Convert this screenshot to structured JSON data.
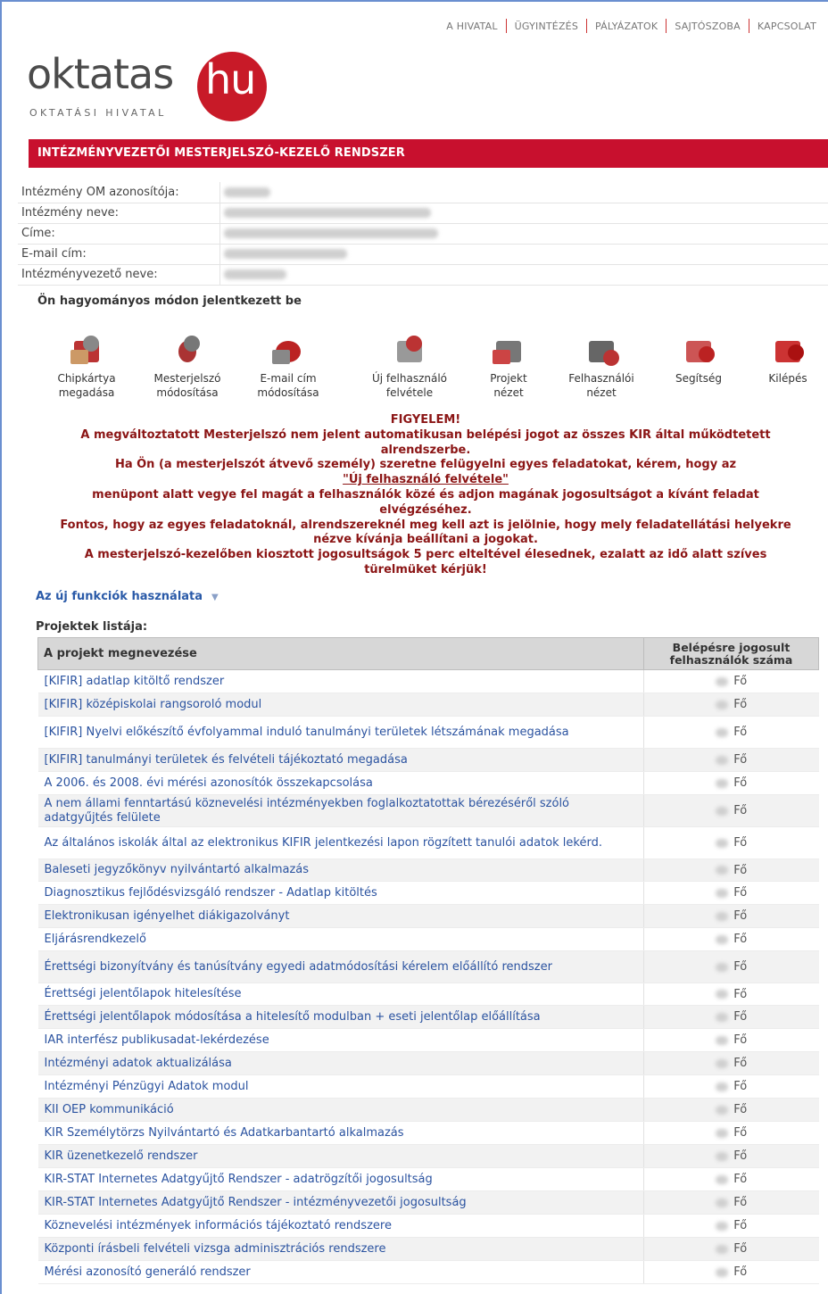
{
  "topnav": [
    "A HIVATAL",
    "ÜGYINTÉZÉS",
    "PÁLYÁZATOK",
    "SAJTÓSZOBA",
    "KAPCSOLAT"
  ],
  "logo": {
    "word": "oktatas",
    "domain": "hu",
    "subtitle": "OKTATÁSI HIVATAL"
  },
  "banner": "INTÉZMÉNYVEZETŐI MESTERJELSZÓ-KEZELŐ RENDSZER",
  "info_labels": [
    "Intézmény OM azonosítója:",
    "Intézmény neve:",
    "Címe:",
    "E-mail cím:",
    "Intézményvezető neve:"
  ],
  "login_note": "Ön hagyományos módon jelentkezett be",
  "tools": [
    {
      "l1": "Chipkártya",
      "l2": "megadása",
      "icon": "chipcard-icon"
    },
    {
      "l1": "Mesterjelszó",
      "l2": "módosítása",
      "icon": "keys-icon"
    },
    {
      "l1": "E-mail cím",
      "l2": "módosítása",
      "icon": "email-icon"
    },
    {
      "l1": "Új felhasználó",
      "l2": "felvétele",
      "icon": "add-user-icon"
    },
    {
      "l1": "Projekt",
      "l2": "nézet",
      "icon": "project-icon"
    },
    {
      "l1": "Felhasználói",
      "l2": "nézet",
      "icon": "user-view-icon"
    },
    {
      "l1": "Segítség",
      "l2": "",
      "icon": "help-icon"
    },
    {
      "l1": "Kilépés",
      "l2": "",
      "icon": "logout-icon"
    }
  ],
  "warning": {
    "title": "FIGYELEM!",
    "l1": "A megváltoztatott Mesterjelszó nem jelent automatikusan belépési jogot az összes KIR által működtetett",
    "l2": "alrendszerbe.",
    "l3": "Ha Ön (a mesterjelszót átvevő személy) szeretne felügyelni egyes feladatokat, kérem, hogy az",
    "l4": "\"Új felhasználó felvétele\"",
    "l5": "menüpont alatt vegye fel magát a felhasználók közé és adjon magának jogosultságot a kívánt feladat",
    "l6": "elvégzéséhez.",
    "l7": "Fontos, hogy az egyes feladatoknál, alrendszereknél meg kell azt is jelölnie, hogy mely feladatellátási helyekre",
    "l8": "nézve kívánja beállítani a jogokat.",
    "l9": "A mesterjelszó-kezelőben kiosztott jogosultságok 5 perc elteltével élesednek, ezalatt az idő alatt szíves",
    "l10": "türelmüket kérjük!"
  },
  "functions_link": "Az új funkciók használata",
  "projects_title": "Projektek listája:",
  "table": {
    "col1": "A projekt megnevezése",
    "col2_l1": "Belépésre jogosult",
    "col2_l2": "felhasználók száma",
    "unit": "Fő",
    "rows": [
      "[KIFIR] adatlap kitöltő rendszer",
      "[KIFIR] középiskolai rangsoroló modul",
      "[KIFIR] Nyelvi előkészítő évfolyammal induló tanulmányi területek létszámának megadása",
      "[KIFIR] tanulmányi területek és felvételi tájékoztató megadása",
      "A 2006. és 2008. évi mérési azonosítók összekapcsolása",
      "A nem állami fenntartású köznevelési intézményekben foglalkoztatottak bérezéséről szóló adatgyűjtés felülete",
      "Az általános iskolák által az elektronikus KIFIR jelentkezési lapon rögzített tanulói adatok lekérd.",
      "Baleseti jegyzőkönyv nyilvántartó alkalmazás",
      "Diagnosztikus fejlődésvizsgáló rendszer - Adatlap kitöltés",
      "Elektronikusan igényelhet diákigazolványt",
      "Eljárásrendkezelő",
      "Érettségi bizonyítvány és tanúsítvány egyedi adatmódosítási kérelem előállító rendszer",
      "Érettségi jelentőlapok hitelesítése",
      "Érettségi jelentőlapok módosítása a hitelesítő modulban + eseti jelentőlap előállítása",
      "IAR interfész publikusadat-lekérdezése",
      "Intézményi adatok aktualizálása",
      "Intézményi Pénzügyi Adatok modul",
      "KII OEP kommunikáció",
      "KIR Személytörzs Nyilvántartó és Adatkarbantartó alkalmazás",
      "KIR üzenetkezelő rendszer",
      "KIR-STAT Internetes Adatgyűjtő Rendszer - adatrögzítői jogosultság",
      "KIR-STAT Internetes Adatgyűjtő Rendszer - intézményvezetői jogosultság",
      "Köznevelési intézmények információs tájékoztató rendszere",
      "Központi írásbeli felvételi vizsga adminisztrációs rendszere",
      "Mérési azonosító generáló rendszer"
    ]
  }
}
